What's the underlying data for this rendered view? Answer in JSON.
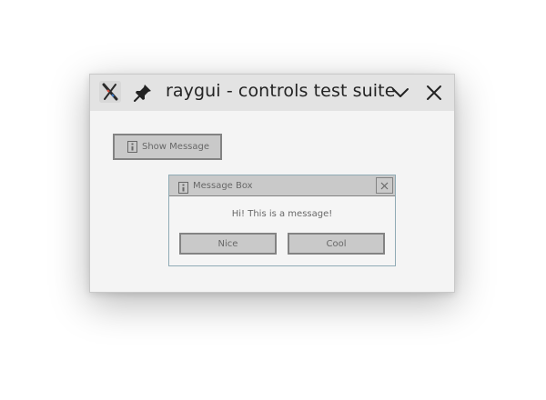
{
  "window": {
    "title": "raygui - controls test suite",
    "app_icon": "raygui-app-icon",
    "pin_icon": "pin-icon",
    "minimize_icon": "chevron-down-icon",
    "close_icon": "close-icon"
  },
  "main": {
    "show_message_label": "Show Message",
    "show_message_icon": "info-icon"
  },
  "message_box": {
    "title": "Message Box",
    "title_icon": "info-icon",
    "text": "Hi! This is a message!",
    "buttons": [
      {
        "label": "Nice"
      },
      {
        "label": "Cool"
      }
    ]
  },
  "colors": {
    "window_bg": "#f4f4f4",
    "titlebar_bg": "#e3e3e3",
    "control_bg": "#c9c9c9",
    "control_border": "#838383",
    "control_text": "#686868",
    "msgbox_border": "#90abb5"
  }
}
